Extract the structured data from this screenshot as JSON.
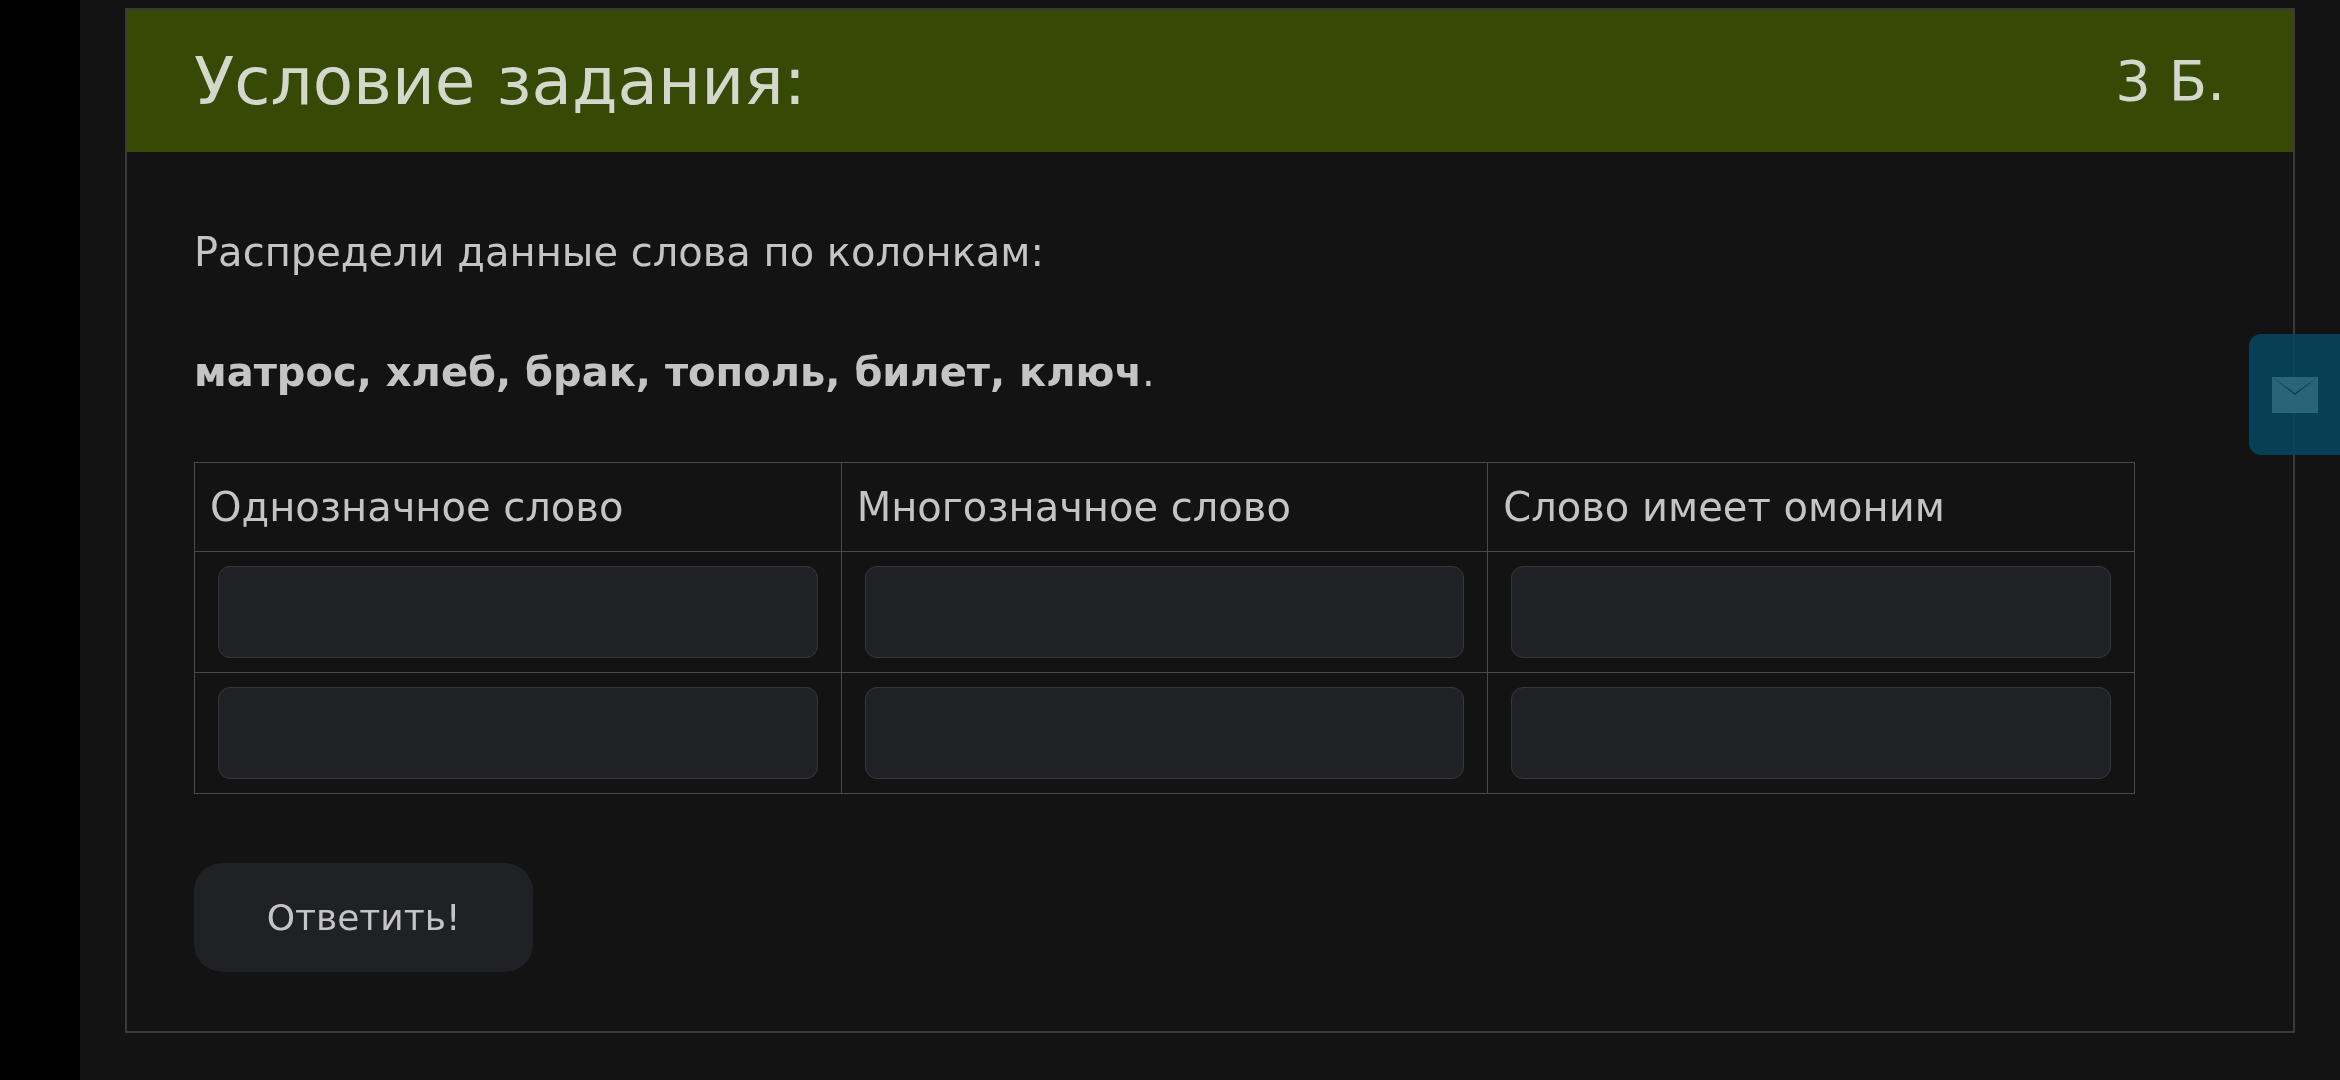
{
  "task": {
    "title": "Условие задания:",
    "points": "3 Б.",
    "instruction": "Распредели данные слова по колонкам:",
    "words": "**матрос, хлеб, брак, тополь, билет, ключ**."
  },
  "table": {
    "columns": [
      "Однозначное слово",
      "Многозначное слово",
      "Слово имеет омоним"
    ],
    "rows": [
      {
        "cells": [
          {
            "kind": "input"
          },
          {
            "kind": "input"
          },
          {
            "kind": "input"
          }
        ]
      },
      {
        "cells": [
          {
            "kind": "input"
          },
          {
            "kind": "input"
          },
          {
            "kind": "input"
          }
        ]
      }
    ]
  },
  "submit_button": "Ответить!"
}
